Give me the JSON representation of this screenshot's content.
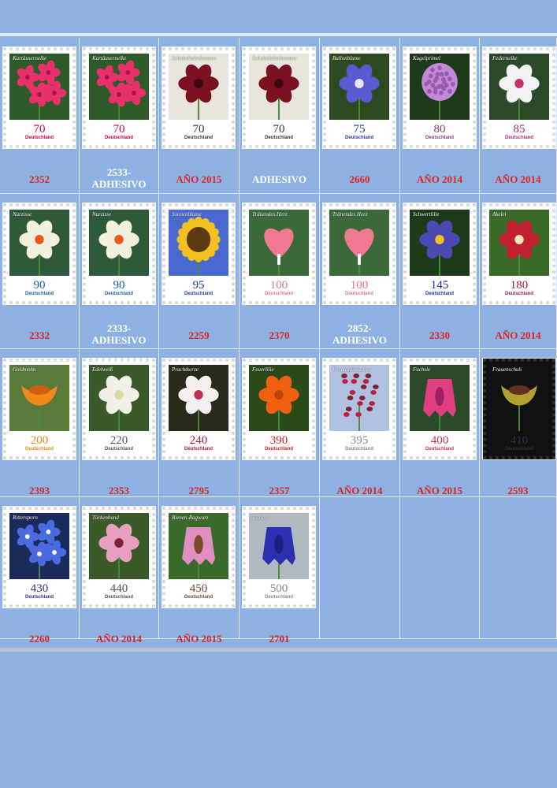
{
  "rows": [
    {
      "cells": [
        {
          "flower": "Kartäusernelke",
          "value": "70",
          "country": "Deutschland",
          "label": "2352",
          "label_color": "red",
          "value_color": "#c8004e",
          "art": "pink"
        },
        {
          "flower": "Kartäusernelke",
          "value": "70",
          "country": "Deutschland",
          "label": "2533-ADHESIVO",
          "label_color": "white",
          "value_color": "#c8004e",
          "art": "pink"
        },
        {
          "flower": "Schokoladenkosmee",
          "value": "70",
          "country": "Deutschland",
          "label": "AÑO 2015",
          "label_color": "red",
          "value_color": "#333333",
          "art": "maroon"
        },
        {
          "flower": "Schokoladenkosmee",
          "value": "70",
          "country": "Deutschland",
          "label": "ADHESIVO",
          "label_color": "white",
          "value_color": "#333333",
          "art": "maroon"
        },
        {
          "flower": "Ballonblume",
          "value": "75",
          "country": "Deutschland",
          "label": "2660",
          "label_color": "red",
          "value_color": "#2d3b8f",
          "art": "blue"
        },
        {
          "flower": "Kugelprimel",
          "value": "80",
          "country": "Deutschland",
          "label": "AÑO 2014",
          "label_color": "red",
          "value_color": "#7a3f7a",
          "art": "purple"
        },
        {
          "flower": "Federnelke",
          "value": "85",
          "country": "Deutschland",
          "label": "AÑO 2014",
          "label_color": "red",
          "value_color": "#a0306a",
          "art": "white"
        }
      ]
    },
    {
      "cells": [
        {
          "flower": "Narzisse",
          "value": "90",
          "country": "Deutschland",
          "label": "2332",
          "label_color": "red",
          "value_color": "#1a5fa8",
          "art": "narcissus"
        },
        {
          "flower": "Narzisse",
          "value": "90",
          "country": "Deutschland",
          "label": "2333-ADHESIVO",
          "label_color": "white",
          "value_color": "#1a5fa8",
          "art": "narcissus"
        },
        {
          "flower": "Sonnenblume",
          "value": "95",
          "country": "Deutschland",
          "label": "2259",
          "label_color": "red",
          "value_color": "#1a3f8f",
          "art": "sunflower"
        },
        {
          "flower": "Tränendes Herz",
          "value": "100",
          "country": "Deutschland",
          "label": "2370",
          "label_color": "red",
          "value_color": "#e07890",
          "art": "heart"
        },
        {
          "flower": "Tränendes Herz",
          "value": "100",
          "country": "Deutschland",
          "label": "2852-ADHESIVO",
          "label_color": "white",
          "value_color": "#e07890",
          "art": "heart"
        },
        {
          "flower": "Schwertlilie",
          "value": "145",
          "country": "Deutschland",
          "label": "2330",
          "label_color": "red",
          "value_color": "#1a2f8f",
          "art": "iris"
        },
        {
          "flower": "Akelei",
          "value": "180",
          "country": "Deutschland",
          "label": "AÑO 2014",
          "label_color": "red",
          "value_color": "#a02040",
          "art": "columbine"
        }
      ]
    },
    {
      "cells": [
        {
          "flower": "Goldmohn",
          "value": "200",
          "country": "Deutschland",
          "label": "2393",
          "label_color": "red",
          "value_color": "#e08a1a",
          "art": "poppy"
        },
        {
          "flower": "Edelweiß",
          "value": "220",
          "country": "Deutschland",
          "label": "2353",
          "label_color": "red",
          "value_color": "#555555",
          "art": "edelweiss"
        },
        {
          "flower": "Prachtkerze",
          "value": "240",
          "country": "Deutschland",
          "label": "2795",
          "label_color": "red",
          "value_color": "#a02040",
          "art": "gaura"
        },
        {
          "flower": "Feuerlilie",
          "value": "390",
          "country": "Deutschland",
          "label": "2357",
          "label_color": "red",
          "value_color": "#d02020",
          "art": "lily"
        },
        {
          "flower": "Purpurglöckchen",
          "value": "395",
          "country": "Deutschland",
          "label": "AÑO 2014",
          "label_color": "red",
          "value_color": "#8a8a8a",
          "art": "heuchera"
        },
        {
          "flower": "Fuchsie",
          "value": "400",
          "country": "Deutschland",
          "label": "AÑO 2015",
          "label_color": "red",
          "value_color": "#c0306a",
          "art": "fuchsia"
        },
        {
          "flower": "Frauenschuh",
          "value": "410",
          "country": "Deutschland",
          "label": "2593",
          "label_color": "red",
          "value_color": "#333333",
          "art": "ladyslipper"
        }
      ]
    },
    {
      "cells": [
        {
          "flower": "Rittersporn",
          "value": "430",
          "country": "Deutschland",
          "label": "2260",
          "label_color": "red",
          "value_color": "#3a2f7f",
          "art": "delphinium"
        },
        {
          "flower": "Türkenbund",
          "value": "440",
          "country": "Deutschland",
          "label": "AÑO 2014",
          "label_color": "red",
          "value_color": "#555555",
          "art": "martagon"
        },
        {
          "flower": "Bienen-Ragwurz",
          "value": "450",
          "country": "Deutschland",
          "label": "AÑO 2015",
          "label_color": "red",
          "value_color": "#7a4a2a",
          "art": "orchid"
        },
        {
          "flower": "Enzian",
          "value": "500",
          "country": "Deutschland",
          "label": "2701",
          "label_color": "red",
          "value_color": "#8a8a8a",
          "art": "gentian"
        }
      ]
    }
  ]
}
